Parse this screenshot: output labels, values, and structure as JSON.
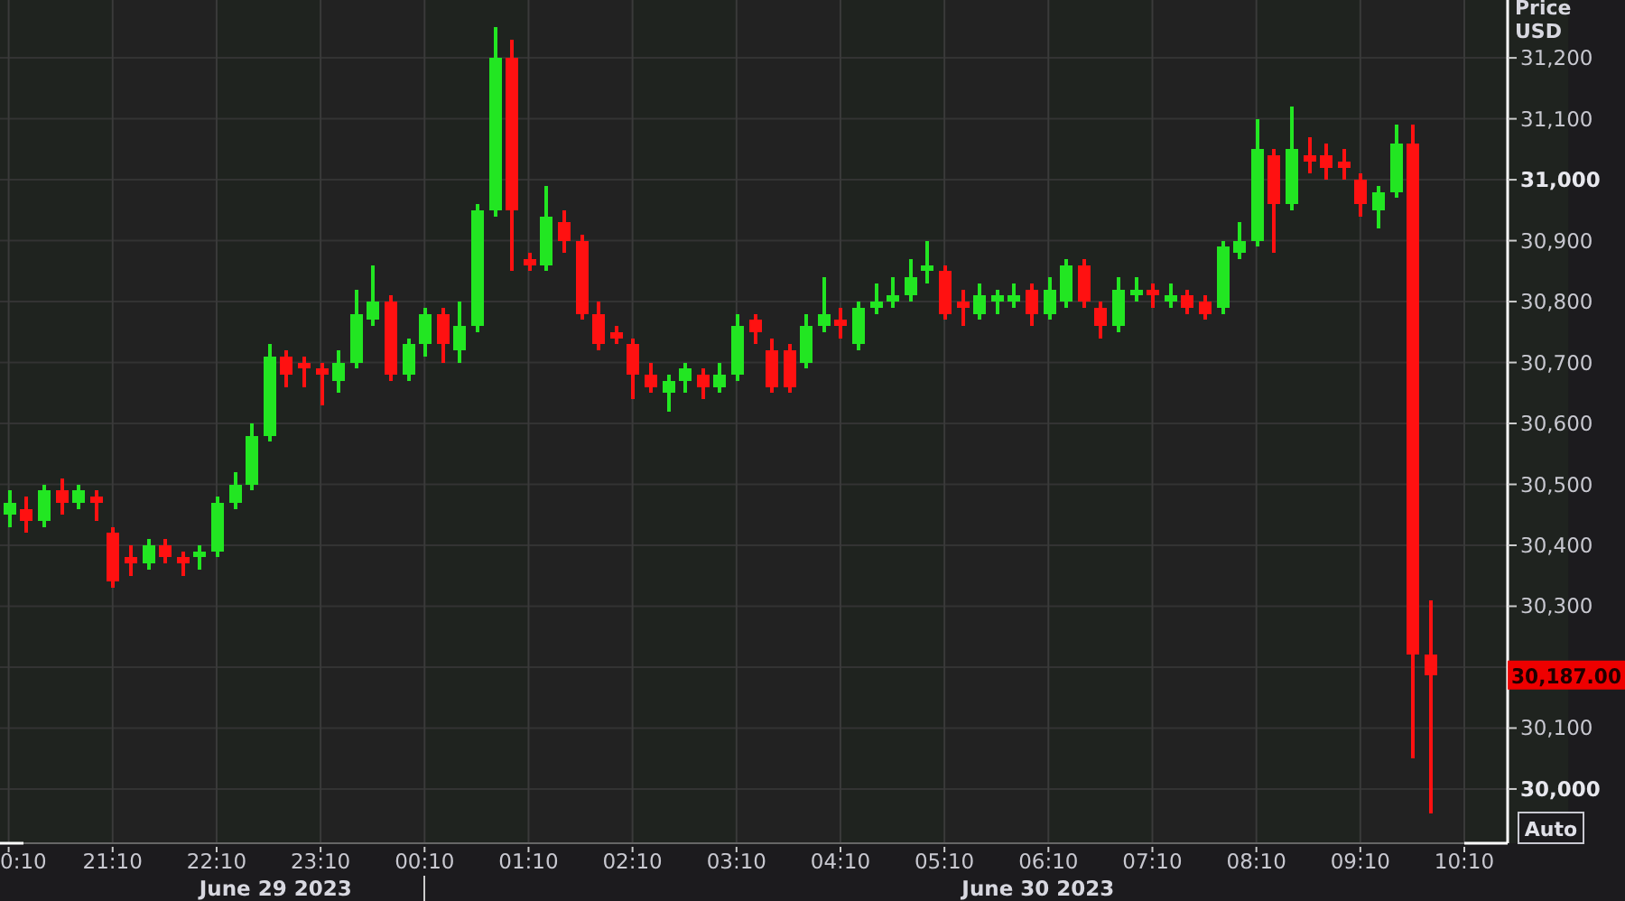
{
  "chart": {
    "header": [
      "Price",
      "USD"
    ],
    "current_price": "30,187.00",
    "auto_button": "Auto",
    "edge_tick_label": "0:10",
    "date_labels": [
      "June 29 2023",
      "June 30 2023"
    ],
    "chart_data": {
      "type": "candlestick",
      "grid": true,
      "ylim": [
        29911,
        31295
      ],
      "yticks": [
        {
          "value": 30000,
          "label": "30,000"
        },
        {
          "value": 30100,
          "label": "30,100"
        },
        {
          "value": 30300,
          "label": "30,300"
        },
        {
          "value": 30400,
          "label": "30,400"
        },
        {
          "value": 30500,
          "label": "30,500"
        },
        {
          "value": 30600,
          "label": "30,600"
        },
        {
          "value": 30700,
          "label": "30,700"
        },
        {
          "value": 30800,
          "label": "30,800"
        },
        {
          "value": 30900,
          "label": "30,900"
        },
        {
          "value": 31000,
          "label": "31,000"
        },
        {
          "value": 31100,
          "label": "31,100"
        },
        {
          "value": 31200,
          "label": "31,200"
        }
      ],
      "categories": [
        null,
        null,
        null,
        null,
        null,
        null,
        "21:10",
        null,
        null,
        null,
        null,
        null,
        "22:10",
        null,
        null,
        null,
        null,
        null,
        "23:10",
        null,
        null,
        null,
        null,
        null,
        "00:10",
        null,
        null,
        null,
        null,
        null,
        "01:10",
        null,
        null,
        null,
        null,
        null,
        "02:10",
        null,
        null,
        null,
        null,
        null,
        "03:10",
        null,
        null,
        null,
        null,
        null,
        "04:10",
        null,
        null,
        null,
        null,
        null,
        "05:10",
        null,
        null,
        null,
        null,
        null,
        "06:10",
        null,
        null,
        null,
        null,
        null,
        "07:10",
        null,
        null,
        null,
        null,
        null,
        "08:10",
        null,
        null,
        null,
        null,
        null,
        "09:10",
        null,
        null,
        null,
        null,
        null,
        "10:10",
        null,
        null
      ],
      "ohlc": [
        [
          30450,
          30490,
          30430,
          30470
        ],
        [
          30460,
          30480,
          30420,
          30440
        ],
        [
          30440,
          30500,
          30430,
          30490
        ],
        [
          30490,
          30510,
          30450,
          30470
        ],
        [
          30470,
          30500,
          30460,
          30490
        ],
        [
          30480,
          30490,
          30440,
          30470
        ],
        [
          30420,
          30430,
          30330,
          30340
        ],
        [
          30380,
          30400,
          30350,
          30370
        ],
        [
          30370,
          30410,
          30360,
          30400
        ],
        [
          30400,
          30410,
          30370,
          30380
        ],
        [
          30380,
          30390,
          30350,
          30370
        ],
        [
          30380,
          30400,
          30360,
          30390
        ],
        [
          30390,
          30480,
          30380,
          30470
        ],
        [
          30470,
          30520,
          30460,
          30500
        ],
        [
          30500,
          30600,
          30490,
          30580
        ],
        [
          30580,
          30730,
          30570,
          30710
        ],
        [
          30710,
          30720,
          30660,
          30680
        ],
        [
          30700,
          30710,
          30660,
          30690
        ],
        [
          30690,
          30700,
          30630,
          30680
        ],
        [
          30670,
          30720,
          30650,
          30700
        ],
        [
          30700,
          30820,
          30690,
          30780
        ],
        [
          30770,
          30860,
          30760,
          30800
        ],
        [
          30800,
          30810,
          30670,
          30680
        ],
        [
          30680,
          30740,
          30670,
          30730
        ],
        [
          30730,
          30790,
          30710,
          30780
        ],
        [
          30780,
          30790,
          30700,
          30730
        ],
        [
          30720,
          30800,
          30700,
          30760
        ],
        [
          30760,
          30960,
          30750,
          30950
        ],
        [
          30950,
          31250,
          30940,
          31200
        ],
        [
          31200,
          31230,
          30850,
          30950
        ],
        [
          30870,
          30880,
          30850,
          30860
        ],
        [
          30860,
          30990,
          30850,
          30940
        ],
        [
          30930,
          30950,
          30880,
          30900
        ],
        [
          30900,
          30910,
          30770,
          30780
        ],
        [
          30780,
          30800,
          30720,
          30730
        ],
        [
          30750,
          30760,
          30730,
          30740
        ],
        [
          30730,
          30740,
          30640,
          30680
        ],
        [
          30680,
          30700,
          30650,
          30660
        ],
        [
          30650,
          30680,
          30620,
          30670
        ],
        [
          30670,
          30700,
          30650,
          30690
        ],
        [
          30680,
          30690,
          30640,
          30660
        ],
        [
          30660,
          30700,
          30650,
          30680
        ],
        [
          30680,
          30780,
          30670,
          30760
        ],
        [
          30770,
          30780,
          30730,
          30750
        ],
        [
          30720,
          30740,
          30650,
          30660
        ],
        [
          30720,
          30730,
          30650,
          30660
        ],
        [
          30700,
          30780,
          30690,
          30760
        ],
        [
          30760,
          30840,
          30750,
          30780
        ],
        [
          30770,
          30790,
          30740,
          30760
        ],
        [
          30730,
          30800,
          30720,
          30790
        ],
        [
          30790,
          30830,
          30780,
          30800
        ],
        [
          30800,
          30840,
          30790,
          30810
        ],
        [
          30810,
          30870,
          30800,
          30840
        ],
        [
          30850,
          30900,
          30830,
          30860
        ],
        [
          30850,
          30860,
          30770,
          30780
        ],
        [
          30800,
          30820,
          30760,
          30790
        ],
        [
          30780,
          30830,
          30770,
          30810
        ],
        [
          30800,
          30820,
          30780,
          30810
        ],
        [
          30800,
          30830,
          30790,
          30810
        ],
        [
          30820,
          30830,
          30760,
          30780
        ],
        [
          30780,
          30840,
          30770,
          30820
        ],
        [
          30800,
          30870,
          30790,
          30860
        ],
        [
          30860,
          30870,
          30790,
          30800
        ],
        [
          30790,
          30800,
          30740,
          30760
        ],
        [
          30760,
          30840,
          30750,
          30820
        ],
        [
          30810,
          30840,
          30800,
          30820
        ],
        [
          30820,
          30830,
          30790,
          30810
        ],
        [
          30800,
          30830,
          30790,
          30810
        ],
        [
          30810,
          30820,
          30780,
          30790
        ],
        [
          30800,
          30810,
          30770,
          30780
        ],
        [
          30790,
          30900,
          30780,
          30890
        ],
        [
          30880,
          30930,
          30870,
          30900
        ],
        [
          30900,
          31100,
          30890,
          31050
        ],
        [
          31040,
          31050,
          30880,
          30960
        ],
        [
          30960,
          31120,
          30950,
          31050
        ],
        [
          31040,
          31070,
          31010,
          31030
        ],
        [
          31040,
          31060,
          31000,
          31020
        ],
        [
          31030,
          31050,
          31000,
          31020
        ],
        [
          31000,
          31010,
          30940,
          30960
        ],
        [
          30950,
          30990,
          30920,
          30980
        ],
        [
          30980,
          31090,
          30970,
          31060
        ],
        [
          31060,
          31090,
          30050,
          30220
        ],
        [
          30220,
          30310,
          29960,
          30187
        ],
        null,
        null,
        null,
        null
      ]
    }
  }
}
